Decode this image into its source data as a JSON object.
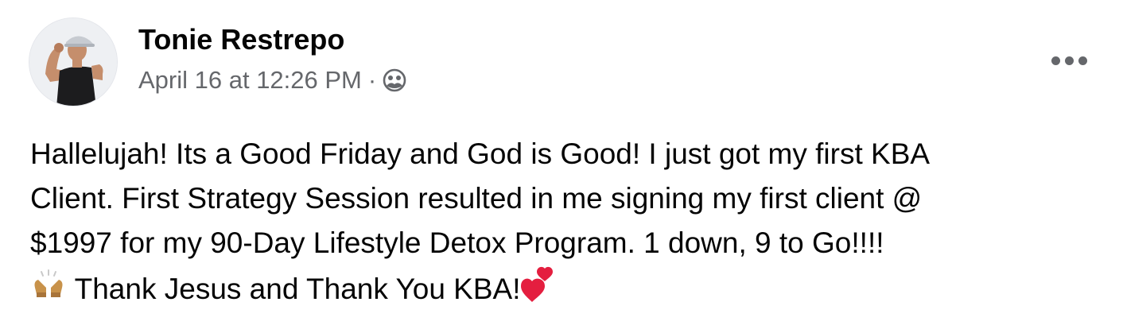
{
  "post": {
    "author_name": "Tonie Restrepo",
    "timestamp": "April 16 at 12:26 PM",
    "separator": "·",
    "audience_icon": "friends-icon",
    "more_icon": "more-options-icon",
    "body_lines": [
      "Hallelujah! Its a Good Friday and God is Good! I just got my first KBA",
      "Client. First Strategy Session resulted in me signing my first client @",
      "$1997 for my 90-Day Lifestyle Detox Program. 1 down, 9 to Go!!!!",
      "Thank Jesus and Thank You KBA!"
    ],
    "emojis": {
      "leading": "raising-hands-emoji",
      "trailing": "heart-exclamation-emoji"
    }
  },
  "colors": {
    "text_primary": "#050505",
    "text_secondary": "#65676b",
    "heart": "#e41e3f"
  }
}
